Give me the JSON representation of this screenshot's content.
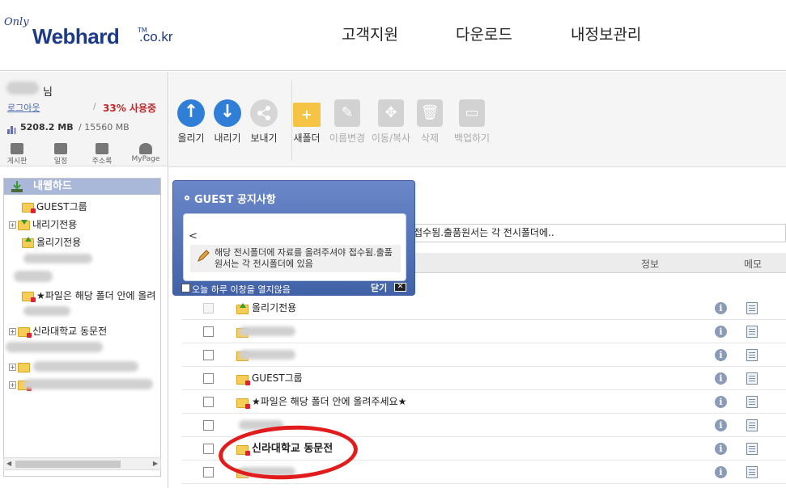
{
  "header": {
    "logo_prefix": "Only",
    "logo_main": "Webhard",
    "logo_tm": "TM",
    "logo_domain": ".co.kr",
    "nav": [
      "고객지원",
      "다운로드",
      "내정보관리"
    ]
  },
  "user": {
    "suffix": "님",
    "logout": "로그아웃",
    "usage_separator": "/",
    "usage_percent": "33% 사용중",
    "used": "5208.2 MB",
    "quota": "/ 15560 MB"
  },
  "quickmenu": [
    "게시판",
    "일정",
    "주소록",
    "MyPage"
  ],
  "tree": {
    "root": "내웹하드",
    "items": [
      {
        "label": "GUEST그룹",
        "icon": "folder-lock"
      },
      {
        "label": "내리기전용",
        "icon": "folder-download"
      },
      {
        "label": "올리기전용",
        "icon": "folder-upload"
      },
      {
        "label": "★파일은 해당 폴더 안에 올려",
        "icon": "folder-lock"
      },
      {
        "label": "신라대학교 동문전",
        "icon": "folder-lock"
      }
    ]
  },
  "toolbar": {
    "upload": "올리기",
    "download": "내리기",
    "send": "보내기",
    "new_folder": "새폴더",
    "rename": "이름변경",
    "move_copy": "이동/복사",
    "delete": "삭제",
    "backup": "백업하기"
  },
  "path_text": "접수됨.출품원서는 각 전시폴더에..",
  "list": {
    "col_info": "정보",
    "col_memo": "메모",
    "rows": [
      {
        "name": "올리기전용",
        "icon": "folder-upload",
        "disabled": true,
        "bold": false
      },
      {
        "name": "",
        "icon": "folder",
        "disabled": false,
        "bold": false
      },
      {
        "name": "",
        "icon": "folder",
        "disabled": false,
        "bold": false
      },
      {
        "name": "GUEST그룹",
        "icon": "folder-lock",
        "disabled": false,
        "bold": false
      },
      {
        "name": "★파일은 해당 폴더 안에 올려주세요★",
        "icon": "folder-lock",
        "disabled": false,
        "bold": false
      },
      {
        "name": "",
        "icon": "none",
        "disabled": false,
        "bold": false
      },
      {
        "name": "신라대학교 동문전",
        "icon": "folder-lock",
        "disabled": false,
        "bold": true
      },
      {
        "name": "",
        "icon": "folder",
        "disabled": false,
        "bold": false
      }
    ]
  },
  "popup": {
    "title": "GUEST 공지사항",
    "back": "<",
    "message": "해당 전시폴더에 자료를 올려주셔야 접수됨.출품원서는 각 전시폴더에 있음",
    "dont_show": "오늘 하루 이창을 열지않음",
    "close": "닫기"
  },
  "colors": {
    "accent_blue": "#2f7fd8",
    "brand": "#1d3a8a",
    "usage_red": "#c0282e",
    "annotation_red": "#e21c1c"
  }
}
